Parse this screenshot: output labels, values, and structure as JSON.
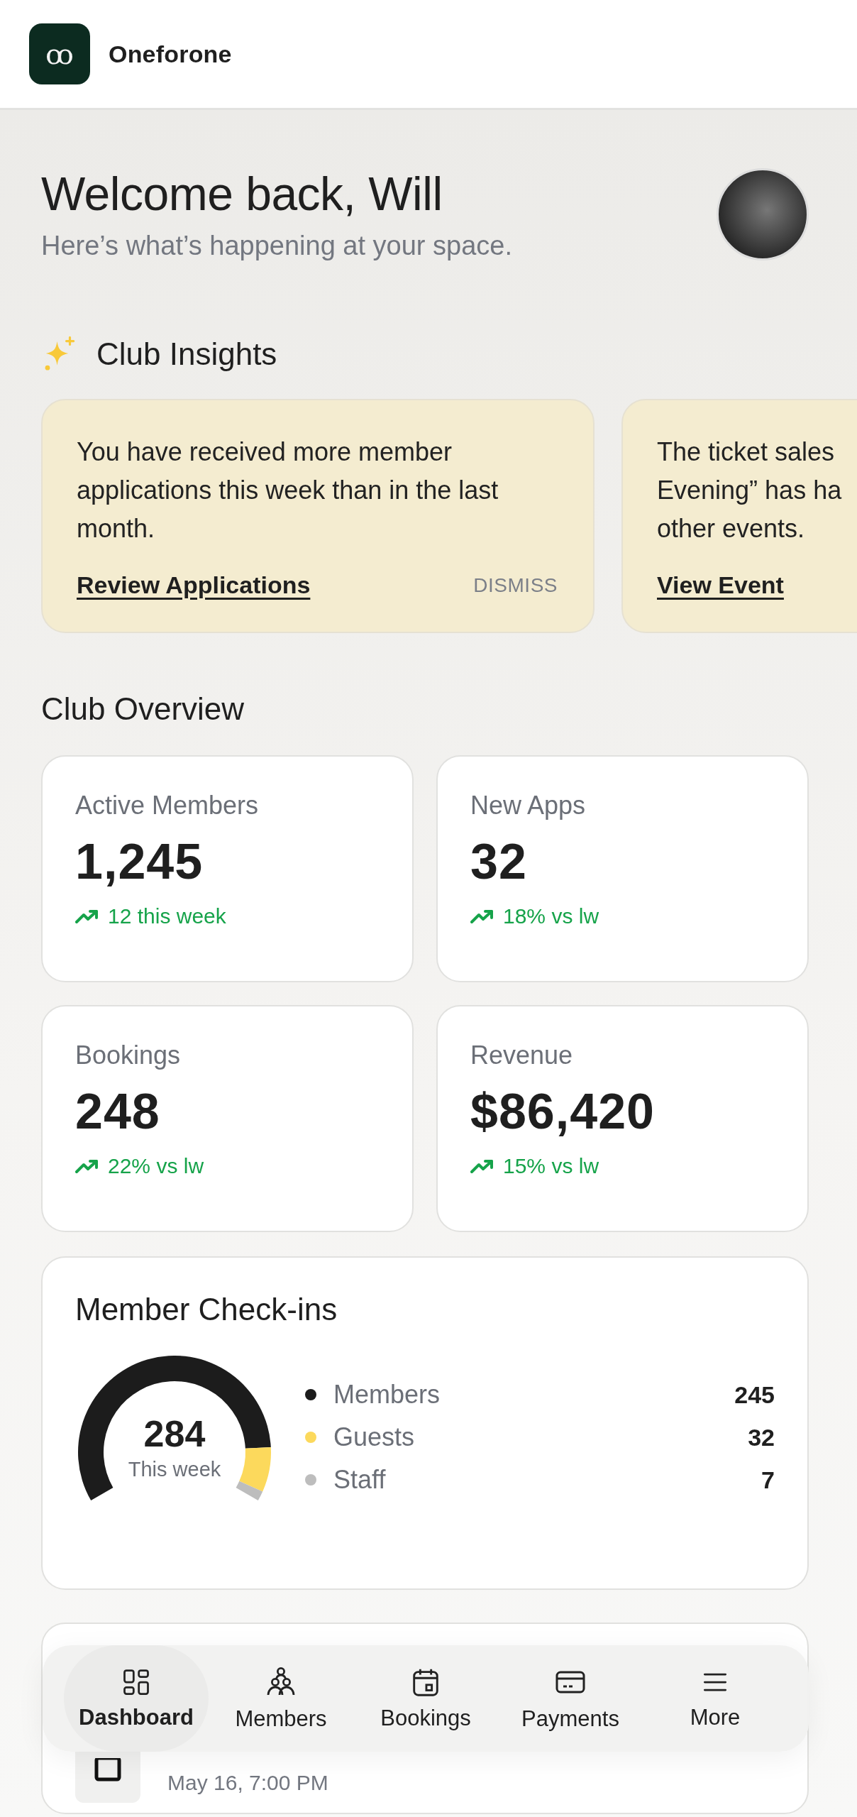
{
  "header": {
    "logo_mark": "ꝏ",
    "brand": "Oneforone"
  },
  "welcome": {
    "title": "Welcome back, Will",
    "subtitle": "Here’s what’s happening at your space."
  },
  "insights": {
    "title": "Club Insights",
    "cards": [
      {
        "text": "You have received more member applications this week than in the last month.",
        "action": "Review Applications",
        "dismiss": "DISMISS"
      },
      {
        "text": "The ticket sales\nEvening” has ha\nother events.",
        "action": "View Event"
      }
    ]
  },
  "overview": {
    "title": "Club Overview",
    "stats": [
      {
        "label": "Active Members",
        "value": "1,245",
        "trend": "12 this week"
      },
      {
        "label": "New Apps",
        "value": "32",
        "trend": "18% vs lw"
      },
      {
        "label": "Bookings",
        "value": "248",
        "trend": "22% vs lw"
      },
      {
        "label": "Revenue",
        "value": "$86,420",
        "trend": "15% vs lw"
      }
    ]
  },
  "checkins": {
    "title": "Member Check-ins",
    "total": "284",
    "caption": "This week",
    "legend": [
      {
        "label": "Members",
        "value": "245",
        "color": "#1c1c1c"
      },
      {
        "label": "Guests",
        "value": "32",
        "color": "#fcd95c"
      },
      {
        "label": "Staff",
        "value": "7",
        "color": "#bdbdbd"
      }
    ]
  },
  "event": {
    "date": "May 16, 7:00 PM"
  },
  "nav": [
    {
      "label": "Dashboard",
      "selected": true
    },
    {
      "label": "Members",
      "selected": false
    },
    {
      "label": "Bookings",
      "selected": false
    },
    {
      "label": "Payments",
      "selected": false
    },
    {
      "label": "More",
      "selected": false
    }
  ]
}
